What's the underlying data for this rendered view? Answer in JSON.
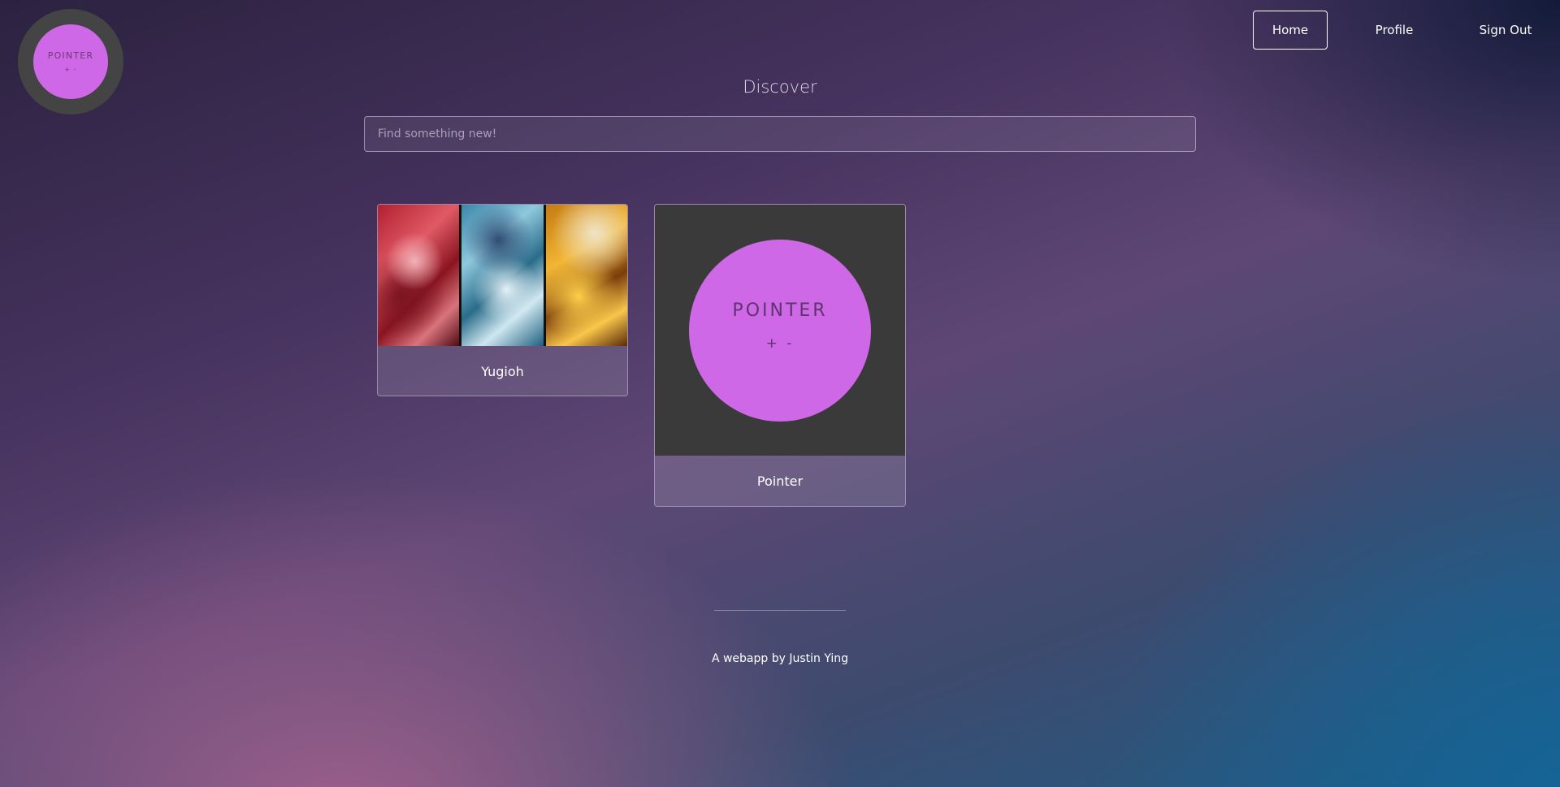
{
  "logo": {
    "word": "POINTER",
    "symbols": "+ -"
  },
  "nav": {
    "home": "Home",
    "profile": "Profile",
    "sign_out": "Sign Out"
  },
  "main": {
    "title": "Discover",
    "search": {
      "placeholder": "Find something new!",
      "value": ""
    },
    "cards": [
      {
        "label": "Yugioh"
      },
      {
        "label": "Pointer",
        "image_word": "POINTER",
        "image_symbols": "+ -"
      }
    ]
  },
  "footer": {
    "text": "A webapp by Justin Ying"
  },
  "colors": {
    "accent_purple": "#cf68e6",
    "tile_dark": "#3a3a3a"
  }
}
